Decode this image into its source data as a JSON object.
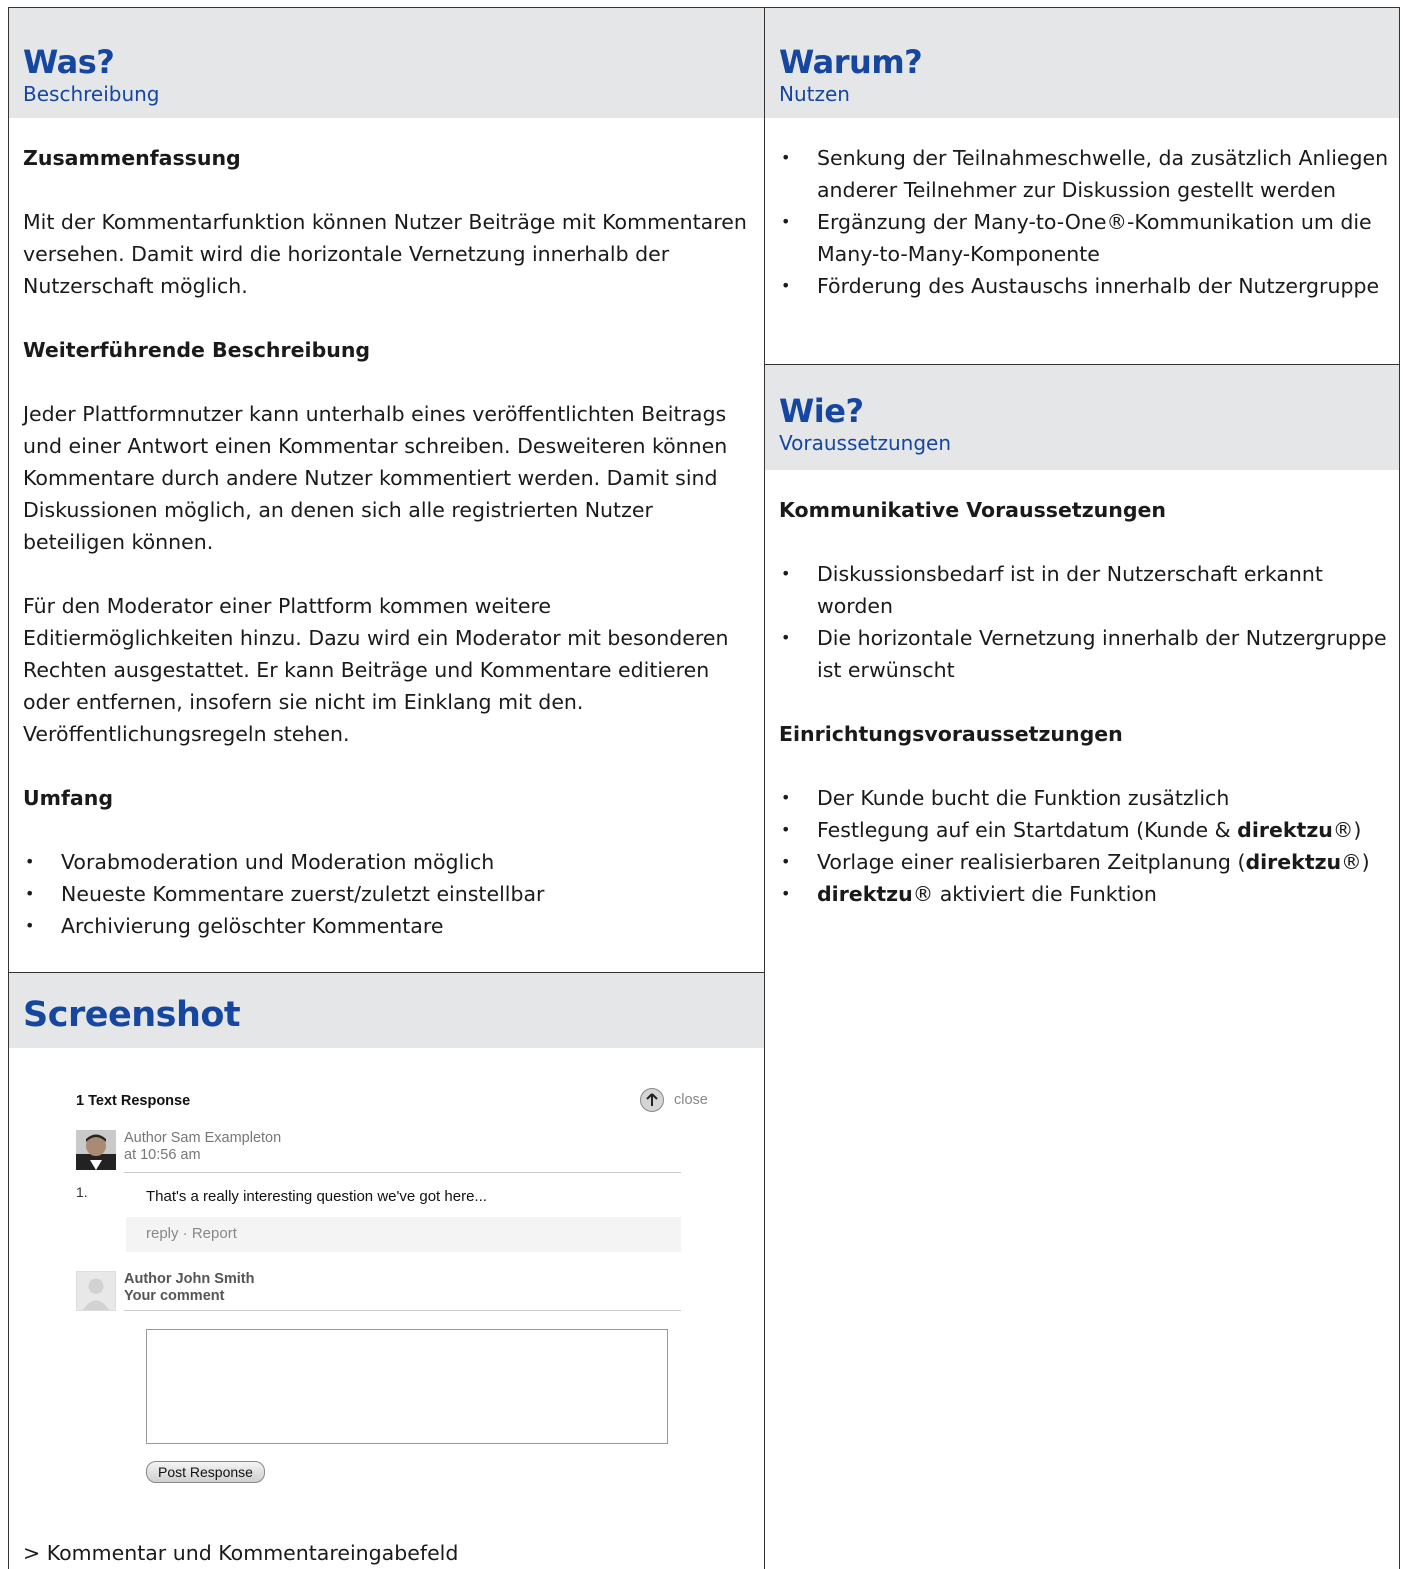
{
  "was": {
    "title": "Was?",
    "subtitle": "Beschreibung",
    "summary_heading": "Zusammenfassung",
    "summary_text": "Mit der Kommentarfunktion können Nutzer Beiträge mit Kommentaren versehen. Damit wird die horizontale Vernetzung innerhalb der Nutzerschaft möglich.",
    "further_heading": "Weiterführende Beschreibung",
    "further_p1": "Jeder Plattformnutzer kann unterhalb eines veröffentlichten Beitrags und einer Antwort einen Kommentar schreiben. Desweiteren können Kommentare durch andere Nutzer kommentiert werden. Damit sind Diskussionen möglich, an denen sich alle registrierten Nutzer beteiligen können.",
    "further_p2": "Für den Moderator einer Plattform kommen weitere Editiermöglichkeiten hinzu. Dazu wird ein Moderator mit besonderen Rechten ausgestattet. Er kann Beiträge und Kommentare editieren oder entfernen, insofern sie nicht im Einklang mit den. Veröffentlichungsregeln stehen.",
    "scope_heading": "Umfang",
    "scope_items": [
      "Vorabmoderation und Moderation möglich",
      "Neueste Kommentare zuerst/zuletzt einstellbar",
      "Archivierung gelöschter Kommentare"
    ]
  },
  "warum": {
    "title": "Warum?",
    "subtitle": "Nutzen",
    "items": [
      "Senkung der  Teilnahmeschwelle, da zusätzlich Anliegen anderer Teilnehmer zur Diskussion gestellt werden",
      "Ergänzung der Many-to-One®-Kommunikation um die Many-to-Many-Komponente",
      "Förderung des Austauschs innerhalb der Nutzergruppe"
    ]
  },
  "wie": {
    "title": "Wie?",
    "subtitle": "Voraussetzungen",
    "comm_heading": "Kommunikative Voraussetzungen",
    "comm_items": [
      "Diskussionsbedarf ist in der Nutzerschaft erkannt worden",
      "Die horizontale Vernetzung  innerhalb der Nutzergruppe ist erwünscht"
    ],
    "setup_heading": "Einrichtungsvoraussetzungen",
    "setup_1": "Der Kunde bucht die Funktion zusätzlich",
    "setup_2_pre": "Festlegung auf ein Startdatum (Kunde & ",
    "setup_2_bold": "direktzu",
    "setup_2_post": "®)",
    "setup_3_pre": "Vorlage einer realisierbaren Zeitplanung (",
    "setup_3_bold": "direktzu",
    "setup_3_post": "®)",
    "setup_4_bold": "direktzu",
    "setup_4_post": "® aktiviert die Funktion"
  },
  "screenshot": {
    "title": "Screenshot",
    "response_title": "1 Text Response",
    "close_label": "close",
    "author1": "Author Sam Exampleton",
    "time1": "at 10:56 am",
    "number": "1.",
    "comment": "That's a really interesting question we've got here...",
    "reply_bar": "reply · Report",
    "author2": "Author John Smith",
    "your_comment": "Your comment",
    "post_button": "Post Response",
    "caption": "> Kommentar und Kommentareingabefeld"
  }
}
